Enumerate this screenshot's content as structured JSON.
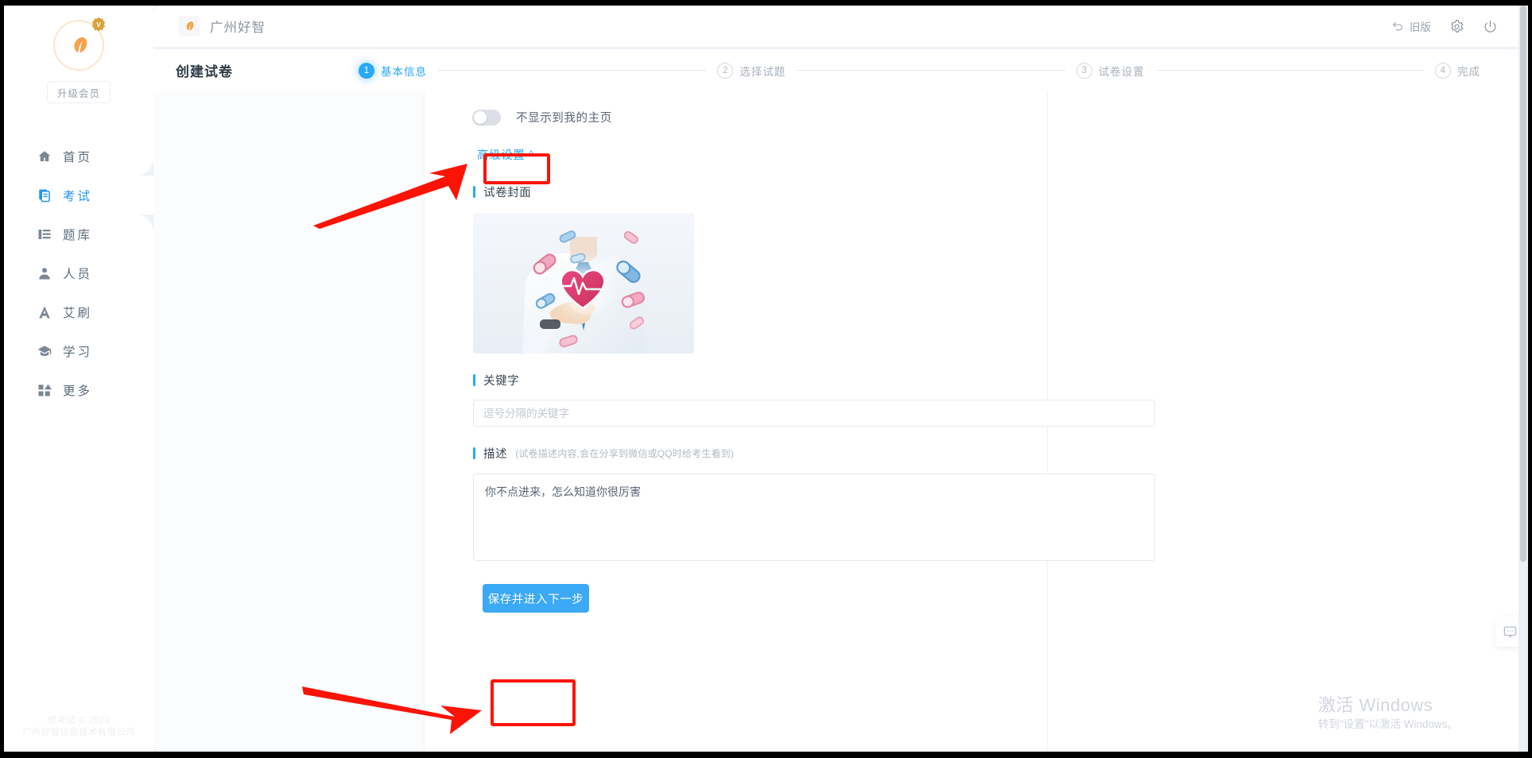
{
  "sidebar": {
    "avatar_icon": "leaf-avatar-icon",
    "vip_badge_icon": "vip-crown-icon",
    "upgrade_label": "升级会员",
    "items": [
      {
        "label": "首页",
        "icon": "home-icon",
        "active": false
      },
      {
        "label": "考试",
        "icon": "exam-document-icon",
        "active": true
      },
      {
        "label": "题库",
        "icon": "question-bank-icon",
        "active": false
      },
      {
        "label": "人员",
        "icon": "user-icon",
        "active": false
      },
      {
        "label": "艾刷",
        "icon": "letter-a-icon",
        "active": false
      },
      {
        "label": "学习",
        "icon": "graduation-cap-icon",
        "active": false
      },
      {
        "label": "更多",
        "icon": "grid-more-icon",
        "active": false
      }
    ],
    "footer_line1": "优考试 © 2023",
    "footer_line2": "广州好智信息技术有限公司"
  },
  "topbar": {
    "brand_logo_icon": "leaf-logo-icon",
    "brand_name": "广州好智",
    "legacy_label": "旧版",
    "legacy_icon": "undo-arrow-icon",
    "settings_icon": "gear-icon",
    "power_icon": "power-icon"
  },
  "header": {
    "page_title": "创建试卷",
    "steps": [
      {
        "num": "1",
        "label": "基本信息",
        "state": "done"
      },
      {
        "num": "2",
        "label": "选择试题",
        "state": "todo"
      },
      {
        "num": "3",
        "label": "试卷设置",
        "state": "todo"
      },
      {
        "num": "4",
        "label": "完成",
        "state": "todo"
      }
    ]
  },
  "form": {
    "hide_toggle": {
      "label": "不显示到我的主页",
      "checked": false
    },
    "advanced_settings": {
      "label": "高级设置",
      "chevron": "︿",
      "expanded": true
    },
    "cover_section": {
      "title": "试卷封面",
      "image_alt": "医生指向心形心电图与漂浮胶囊药丸"
    },
    "keywords_section": {
      "title": "关键字",
      "placeholder": "逗号分隔的关键字",
      "value": ""
    },
    "description_section": {
      "title": "描述",
      "hint": "(试卷描述内容,会在分享到微信或QQ时给考生看到)",
      "value": "你不点进来，怎么知道你很厉害"
    },
    "save_button_label": "保存并进入下一步"
  },
  "annotations": {
    "highlight_color": "#fb1405",
    "arrow_to_advanced": "指向高级设置按钮的红色箭头",
    "arrow_to_save": "指向保存并进入下一步按钮的红色箭头"
  },
  "watermark": {
    "line1": "激活 Windows",
    "line2": "转到\"设置\"以激活 Windows。"
  },
  "float_widget": {
    "icon": "chat-bubble-icon"
  },
  "colors": {
    "accent": "#2aa7f5",
    "primary_button": "#3ba9f5",
    "sidebar_text": "#5d6b7a",
    "highlight_red": "#fb1405"
  }
}
